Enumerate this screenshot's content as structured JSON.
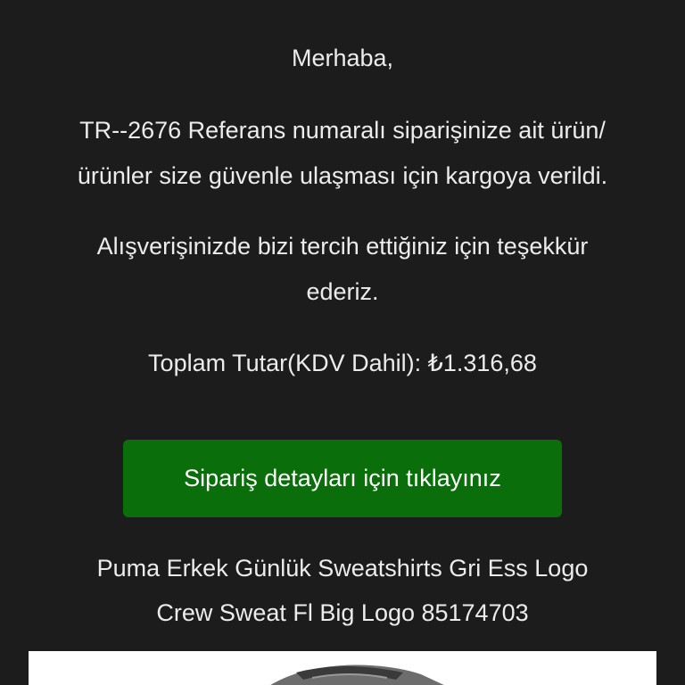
{
  "email": {
    "greeting": "Merhaba,",
    "shipping_message": {
      "line1": "TR--2676 Referans numaralı siparişinize ait ürün/",
      "line2": "ürünler size güvenle ulaşması için kargoya verildi."
    },
    "thanks_message": {
      "line1": "Alışverişinizde bizi tercih ettiğiniz için teşekkür",
      "line2": "ederiz."
    },
    "total": {
      "text": "Toplam Tutar(KDV Dahil): ₺1.316,68"
    },
    "cta_button": {
      "label": "Sipariş detayları için tıklayınız",
      "color": "#0a6e0a"
    },
    "product": {
      "name_line1": "Puma Erkek Günlük Sweatshirts Gri Ess Logo",
      "name_line2": "Crew Sweat Fl Big Logo 85174703"
    }
  },
  "colors": {
    "background": "#1c1c1c",
    "text": "#ececec"
  }
}
